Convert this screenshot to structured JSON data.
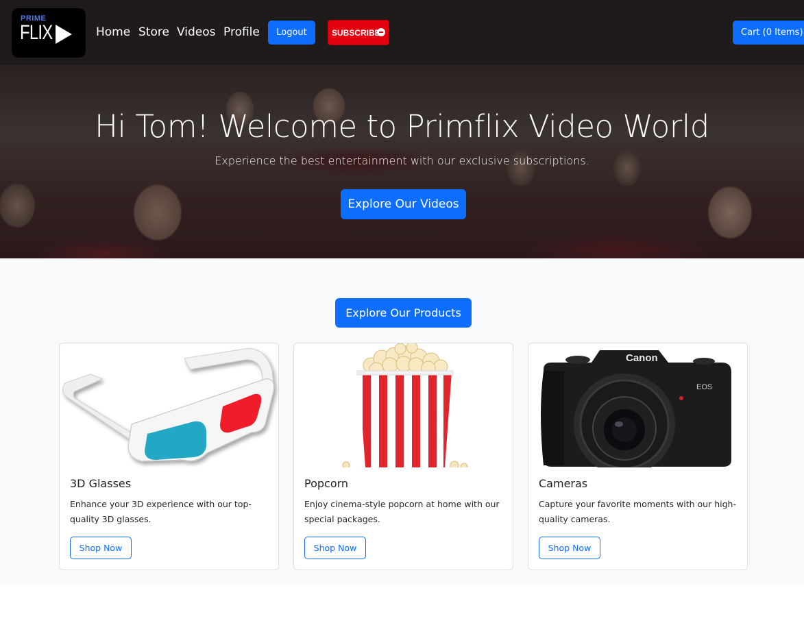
{
  "brand": {
    "logo_top": "PRIME",
    "logo_main": "FLIX",
    "colors": {
      "navbar_bg": "#1f1b1b",
      "primary": "#0d6efd",
      "subscribe": "#e3000f"
    }
  },
  "nav": {
    "links": [
      "Home",
      "Store",
      "Videos",
      "Profile"
    ],
    "logout_label": "Logout",
    "subscribe_label": "SUBSCRIBE",
    "cart_label": "Cart (0 Items)"
  },
  "hero": {
    "title": "Hi Tom! Welcome to Primflix Video World",
    "subtitle": "Experience the best entertainment with our exclusive subscriptions.",
    "button_label": "Explore Our Videos"
  },
  "products": {
    "button_label": "Explore Our Products",
    "items": [
      {
        "title": "3D Glasses",
        "text": "Enhance your 3D experience with our top-quality 3D glasses.",
        "button": "Shop Now",
        "image": "3d-glasses"
      },
      {
        "title": "Popcorn",
        "text": "Enjoy cinema-style popcorn at home with our special packages.",
        "button": "Shop Now",
        "image": "popcorn-bucket"
      },
      {
        "title": "Cameras",
        "text": "Capture your favorite moments with our high-quality cameras.",
        "button": "Shop Now",
        "image": "canon-camera",
        "image_brand": "Canon",
        "image_model": "EOS"
      }
    ]
  }
}
